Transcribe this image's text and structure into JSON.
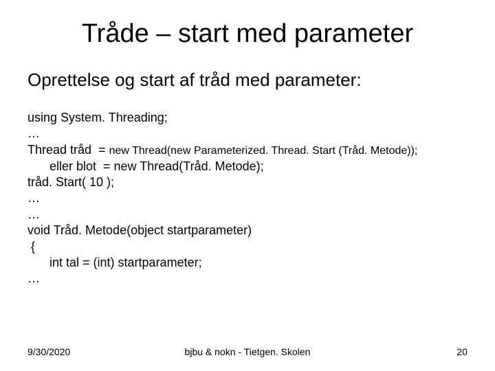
{
  "title": "Tråde – start med parameter",
  "subtitle": "Oprettelse og start af tråd med parameter:",
  "code": {
    "l1": "using System. Threading;",
    "l2": "…",
    "l3a": "Thread tråd  = ",
    "l3b": "new Thread(new Parameterized. Thread. Start (Tråd. Metode));",
    "l4": "eller blot  = new Thread(Tråd. Metode);",
    "l5": "tråd. Start( 10 );",
    "l6": "…",
    "l7": "…",
    "l8": "void Tråd. Metode(object startparameter)",
    "l9": " {",
    "l10": "int tal = (int) startparameter;",
    "l11": "…"
  },
  "footer": {
    "date": "9/30/2020",
    "center": "bjbu & nokn - Tietgen. Skolen",
    "page": "20"
  }
}
